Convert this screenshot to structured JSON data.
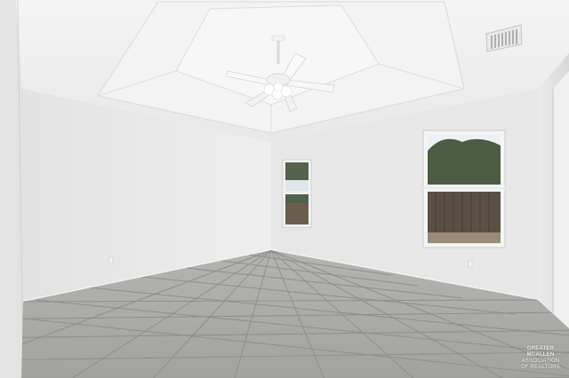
{
  "photo": {
    "subject": "",
    "colors": {
      "ceiling": "#f1f1f1",
      "wall_left": "#ececec",
      "wall_back": "#e6e6e6",
      "wall_right": "#dedede",
      "floor": "#a8a8a4",
      "grout": "#8a8a86",
      "sky": "#eef2f4",
      "foliage": "#4a5a42",
      "fence": "#5a5046"
    },
    "icons": [
      "ceiling-fan-icon",
      "air-vent-icon",
      "window-icon"
    ]
  },
  "watermark": {
    "line1": "GREATER MCALLEN",
    "line2": "ASSOCIATION OF REALTORS"
  }
}
